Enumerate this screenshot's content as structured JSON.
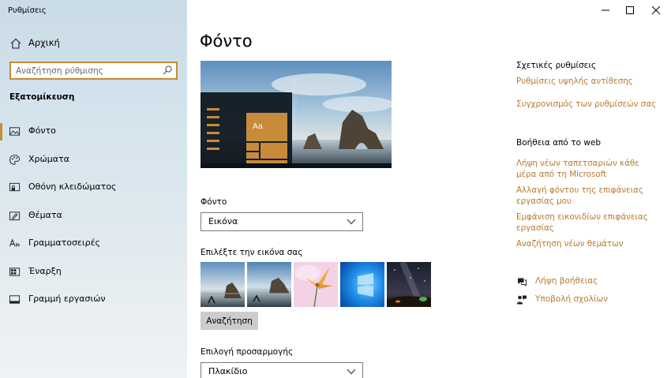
{
  "window": {
    "app_title": "Ρυθμίσεις"
  },
  "sidebar": {
    "home_label": "Αρχική",
    "search_placeholder": "Αναζήτηση ρύθμισης",
    "section_label": "Εξατομίκευση",
    "items": [
      {
        "label": "Φόντο",
        "icon": "picture-icon",
        "active": true
      },
      {
        "label": "Χρώματα",
        "icon": "palette-icon",
        "active": false
      },
      {
        "label": "Οθόνη κλειδώματος",
        "icon": "lock-screen-icon",
        "active": false
      },
      {
        "label": "Θέματα",
        "icon": "themes-icon",
        "active": false
      },
      {
        "label": "Γραμματοσειρές",
        "icon": "fonts-icon",
        "active": false
      },
      {
        "label": "Έναρξη",
        "icon": "start-icon",
        "active": false
      },
      {
        "label": "Γραμμή εργασιών",
        "icon": "taskbar-icon",
        "active": false
      }
    ]
  },
  "main": {
    "page_title": "Φόντο",
    "preview_tile_label": "Aa",
    "background_label": "Φόντο",
    "background_value": "Εικόνα",
    "choose_picture_label": "Επιλέξτε την εικόνα σας",
    "browse_label": "Αναζήτηση",
    "fit_label": "Επιλογή προσαρμογής",
    "fit_value": "Πλακίδιο"
  },
  "related": {
    "heading": "Σχετικές ρυθμίσεις",
    "links": [
      "Ρυθμίσεις υψηλής αντίθεσης",
      "Συγχρονισμός των ρυθμίσεών σας"
    ]
  },
  "web_help": {
    "heading": "Βοήθεια από το web",
    "links": [
      "Λήψη νέων ταπετσαριών κάθε μέρα από τη Microsoft",
      "Αλλαγή φόντου της επιφάνειας εργασίας μου",
      "Εμφάνιση εικονιδίων επιφάνειας εργασίας",
      "Αναζήτηση νέων θεμάτων"
    ]
  },
  "support": {
    "get_help": "Λήψη βοήθειας",
    "feedback": "Υποβολή σχολίων"
  },
  "colors": {
    "accent": "#c78b3a",
    "link": "#b77a2f"
  }
}
